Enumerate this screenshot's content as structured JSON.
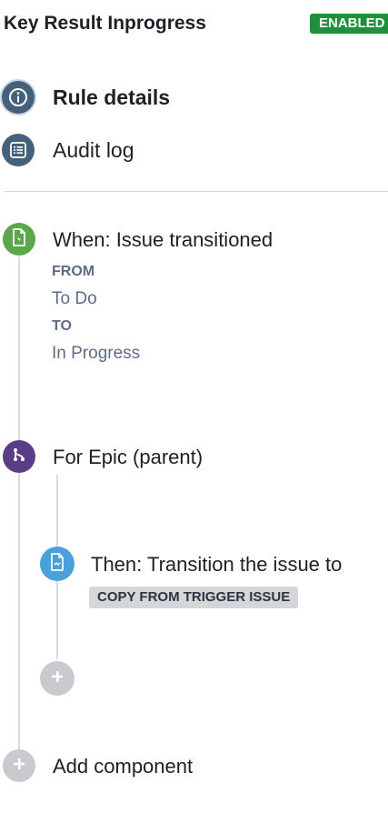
{
  "header": {
    "title": "Key Result Inprogress",
    "status": "ENABLED"
  },
  "nav": {
    "items": [
      {
        "label": "Rule details",
        "icon": "info-icon"
      },
      {
        "label": "Audit log",
        "icon": "list-icon"
      }
    ]
  },
  "trigger": {
    "label": "When: Issue transitioned",
    "icon": "lightning-doc-icon",
    "from_label": "FROM",
    "from_value": "To Do",
    "to_label": "TO",
    "to_value": "In Progress"
  },
  "branch": {
    "label": "For Epic (parent)",
    "icon": "branch-icon"
  },
  "action": {
    "label": "Then: Transition the issue to",
    "icon": "doc-edit-icon",
    "lozenge": "COPY FROM TRIGGER ISSUE"
  },
  "add_component": {
    "label": "Add component"
  },
  "colors": {
    "enabled_badge": "#1f8e3d",
    "nav_icon_bg": "#44617b",
    "trigger_green": "#5aa84a",
    "branch_purple": "#5a3e85",
    "action_blue": "#4aa0d9",
    "add_gray": "#c8cacd",
    "connector_line": "#d6d9dd"
  }
}
